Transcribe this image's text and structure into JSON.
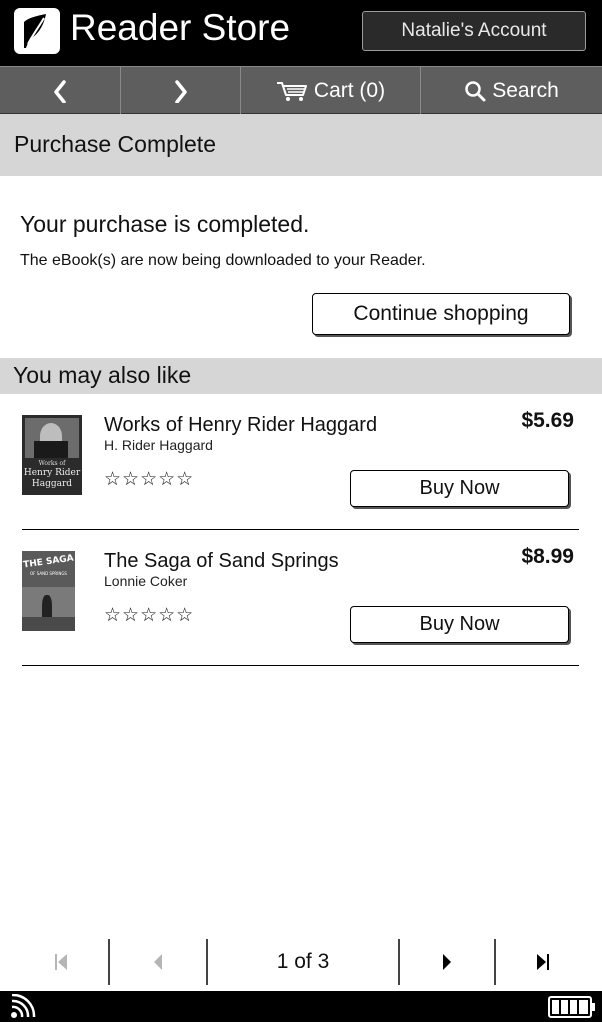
{
  "header": {
    "app_title": "Reader Store",
    "account_label": "Natalie's Account"
  },
  "nav": {
    "back_icon": "chevron-left-icon",
    "forward_icon": "chevron-right-icon",
    "cart_label": "Cart (0)",
    "search_label": "Search"
  },
  "purchase": {
    "section_title": "Purchase Complete",
    "heading": "Your purchase is completed.",
    "message": "The eBook(s) are now being downloaded to your Reader.",
    "continue_label": "Continue shopping"
  },
  "recommendations": {
    "section_title": "You may also like",
    "items": [
      {
        "title": "Works of Henry Rider Haggard",
        "author": "H. Rider Haggard",
        "price": "$5.69",
        "rating_stars": "☆☆☆☆☆",
        "rating": 0,
        "buy_label": "Buy Now",
        "cover_text_1": "Works of",
        "cover_text_2": "Henry Rider",
        "cover_text_3": "Haggard"
      },
      {
        "title": "The Saga of Sand Springs",
        "author": "Lonnie Coker",
        "price": "$8.99",
        "rating_stars": "☆☆☆☆☆",
        "rating": 0,
        "buy_label": "Buy Now",
        "cover_text_1": "THE SAGA",
        "cover_text_2": "OF SAND SPRINGS"
      }
    ]
  },
  "pager": {
    "page_indicator": "1 of 3"
  },
  "colors": {
    "header_bg": "#000000",
    "nav_bg": "#5e5e5e",
    "section_bg": "#d6d6d6"
  }
}
